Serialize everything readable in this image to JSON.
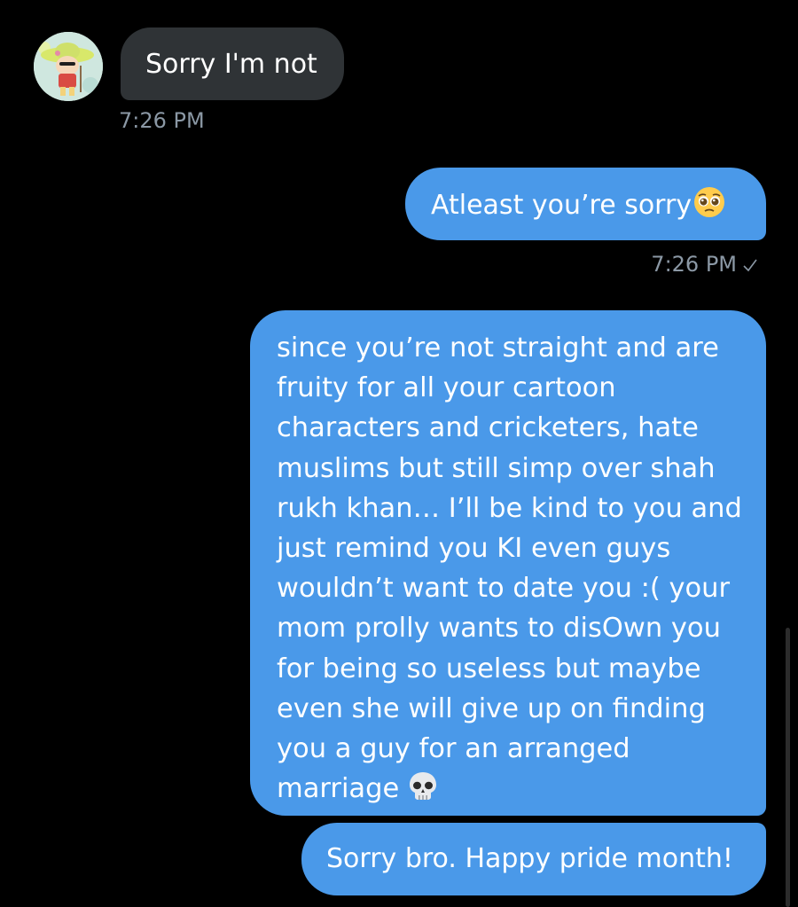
{
  "conversation": {
    "messages": [
      {
        "direction": "received",
        "text": "Sorry I'm not",
        "time": "7:26 PM"
      },
      {
        "direction": "sent",
        "text": "Atleast you’re sorry",
        "emoji": "pleading-face",
        "time": "7:26 PM",
        "status_icon": "check-icon"
      },
      {
        "direction": "sent",
        "text": "since you’re not straight and are fruity for all your cartoon characters and cricketers, hate muslims but still simp over shah rukh khan… I’ll be kind to you and just remind you KI even guys wouldn’t want to date you :( your mom prolly wants to disOwn you for being so useless but maybe even she will give up on finding you a guy for an arranged marriage",
        "emoji": "skull"
      },
      {
        "direction": "sent",
        "text": "Sorry bro. Happy pride month!"
      }
    ]
  },
  "colors": {
    "background": "#000000",
    "received_bubble": "#2f3336",
    "sent_bubble": "#4a99e9",
    "timestamp": "#8b98a5"
  }
}
